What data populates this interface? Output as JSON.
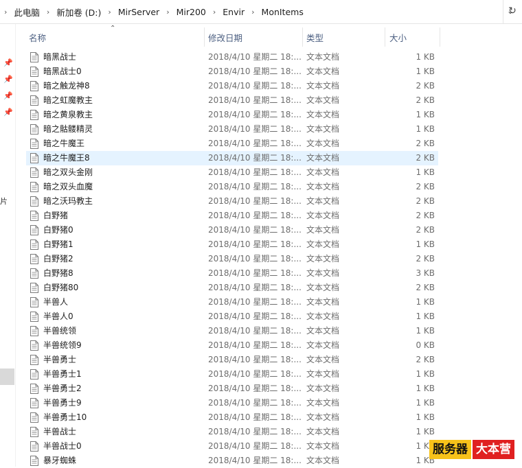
{
  "breadcrumb": [
    "此电脑",
    "新加卷 (D:)",
    "MirServer",
    "Mir200",
    "Envir",
    "MonItems"
  ],
  "columns": {
    "name": "名称",
    "date": "修改日期",
    "type": "类型",
    "size": "大小"
  },
  "nav_partial_text": "片",
  "rows": [
    {
      "name": "暗黑战士",
      "date": "2018/4/10 星期二 18:...",
      "type": "文本文档",
      "size": "1 KB"
    },
    {
      "name": "暗黑战士0",
      "date": "2018/4/10 星期二 18:...",
      "type": "文本文档",
      "size": "1 KB"
    },
    {
      "name": "暗之触龙神8",
      "date": "2018/4/10 星期二 18:...",
      "type": "文本文档",
      "size": "2 KB"
    },
    {
      "name": "暗之虹魔教主",
      "date": "2018/4/10 星期二 18:...",
      "type": "文本文档",
      "size": "2 KB"
    },
    {
      "name": "暗之黄泉教主",
      "date": "2018/4/10 星期二 18:...",
      "type": "文本文档",
      "size": "1 KB"
    },
    {
      "name": "暗之骷髅精灵",
      "date": "2018/4/10 星期二 18:...",
      "type": "文本文档",
      "size": "1 KB"
    },
    {
      "name": "暗之牛魔王",
      "date": "2018/4/10 星期二 18:...",
      "type": "文本文档",
      "size": "2 KB"
    },
    {
      "name": "暗之牛魔王8",
      "date": "2018/4/10 星期二 18:...",
      "type": "文本文档",
      "size": "2 KB",
      "selected": true
    },
    {
      "name": "暗之双头金刚",
      "date": "2018/4/10 星期二 18:...",
      "type": "文本文档",
      "size": "1 KB"
    },
    {
      "name": "暗之双头血魔",
      "date": "2018/4/10 星期二 18:...",
      "type": "文本文档",
      "size": "2 KB"
    },
    {
      "name": "暗之沃玛教主",
      "date": "2018/4/10 星期二 18:...",
      "type": "文本文档",
      "size": "2 KB"
    },
    {
      "name": "白野猪",
      "date": "2018/4/10 星期二 18:...",
      "type": "文本文档",
      "size": "2 KB"
    },
    {
      "name": "白野猪0",
      "date": "2018/4/10 星期二 18:...",
      "type": "文本文档",
      "size": "2 KB"
    },
    {
      "name": "白野猪1",
      "date": "2018/4/10 星期二 18:...",
      "type": "文本文档",
      "size": "1 KB"
    },
    {
      "name": "白野猪2",
      "date": "2018/4/10 星期二 18:...",
      "type": "文本文档",
      "size": "2 KB"
    },
    {
      "name": "白野猪8",
      "date": "2018/4/10 星期二 18:...",
      "type": "文本文档",
      "size": "3 KB"
    },
    {
      "name": "白野猪80",
      "date": "2018/4/10 星期二 18:...",
      "type": "文本文档",
      "size": "2 KB"
    },
    {
      "name": "半兽人",
      "date": "2018/4/10 星期二 18:...",
      "type": "文本文档",
      "size": "1 KB"
    },
    {
      "name": "半兽人0",
      "date": "2018/4/10 星期二 18:...",
      "type": "文本文档",
      "size": "1 KB"
    },
    {
      "name": "半兽统领",
      "date": "2018/4/10 星期二 18:...",
      "type": "文本文档",
      "size": "1 KB"
    },
    {
      "name": "半兽统领9",
      "date": "2018/4/10 星期二 18:...",
      "type": "文本文档",
      "size": "0 KB"
    },
    {
      "name": "半兽勇士",
      "date": "2018/4/10 星期二 18:...",
      "type": "文本文档",
      "size": "2 KB"
    },
    {
      "name": "半兽勇士1",
      "date": "2018/4/10 星期二 18:...",
      "type": "文本文档",
      "size": "1 KB"
    },
    {
      "name": "半兽勇士2",
      "date": "2018/4/10 星期二 18:...",
      "type": "文本文档",
      "size": "1 KB"
    },
    {
      "name": "半兽勇士9",
      "date": "2018/4/10 星期二 18:...",
      "type": "文本文档",
      "size": "1 KB"
    },
    {
      "name": "半兽勇士10",
      "date": "2018/4/10 星期二 18:...",
      "type": "文本文档",
      "size": "1 KB"
    },
    {
      "name": "半兽战士",
      "date": "2018/4/10 星期二 18:...",
      "type": "文本文档",
      "size": "1 KB"
    },
    {
      "name": "半兽战士0",
      "date": "2018/4/10 星期二 18:...",
      "type": "文本文档",
      "size": "1 KB"
    },
    {
      "name": "暴牙蜘蛛",
      "date": "2018/4/10 星期二 18:...",
      "type": "文本文档",
      "size": "1 KB"
    }
  ],
  "watermark": {
    "part1": "服务器",
    "part2": "大本营"
  },
  "icons": {
    "file": "text-file-icon",
    "pin": "pin-icon",
    "dropdown": "chevron-down-icon",
    "refresh": "refresh-icon",
    "breadcrumb_sep": "chevron-right-icon"
  },
  "colors": {
    "selected_row": "#e5f3ff",
    "header_text": "#4d6082",
    "watermark_yellow": "#f7c21a",
    "watermark_red": "#e02020"
  }
}
